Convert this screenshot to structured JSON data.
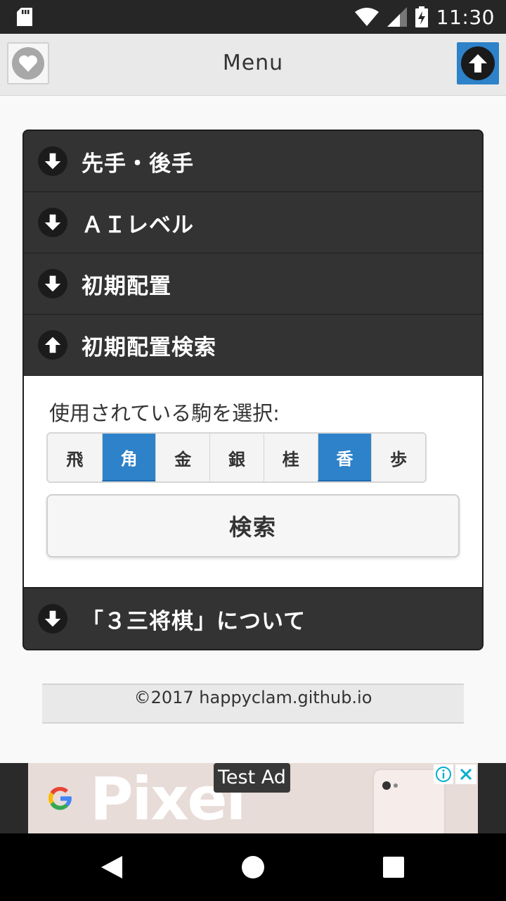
{
  "status_bar": {
    "time": "11:30"
  },
  "header": {
    "title": "Menu"
  },
  "accordion": {
    "sections": [
      {
        "label": "先手・後手",
        "expanded": false
      },
      {
        "label": "ＡＩレベル",
        "expanded": false
      },
      {
        "label": "初期配置",
        "expanded": false
      },
      {
        "label": "初期配置検索",
        "expanded": true
      },
      {
        "label": "「３三将棋」について",
        "expanded": false
      }
    ],
    "search_panel": {
      "prompt": "使用されている駒を選択:",
      "pieces": [
        {
          "label": "飛",
          "selected": false
        },
        {
          "label": "角",
          "selected": true
        },
        {
          "label": "金",
          "selected": false
        },
        {
          "label": "銀",
          "selected": false
        },
        {
          "label": "桂",
          "selected": false
        },
        {
          "label": "香",
          "selected": true
        },
        {
          "label": "歩",
          "selected": false
        }
      ],
      "search_button": "検索"
    }
  },
  "footer": {
    "copyright": "©2017 happyclam.github.io"
  },
  "ad": {
    "brand": "Pixel",
    "badge": "Test Ad"
  },
  "colors": {
    "accent": "#2d82c9",
    "panel": "#333333",
    "header": "#e9e9e9"
  }
}
